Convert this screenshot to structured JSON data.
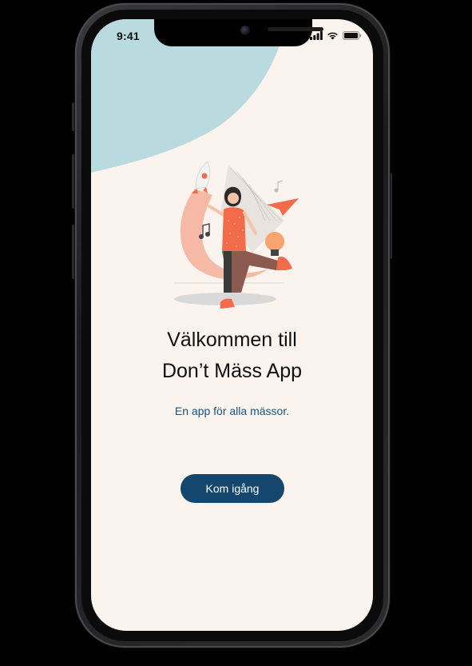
{
  "status_bar": {
    "time": "9:41",
    "icons": [
      "signal-icon",
      "wifi-icon",
      "battery-icon"
    ]
  },
  "welcome": {
    "title_line1": "Välkommen till",
    "title_line2": "Don’t Mäss App",
    "subtitle": "En app för alla mässor.",
    "cta_label": "Kom igång"
  },
  "colors": {
    "background": "#FBF4EE",
    "blob": "#B9DADF",
    "accent_orange": "#F26B4B",
    "primary_blue": "#15476E",
    "subtitle_blue": "#1D5277"
  }
}
